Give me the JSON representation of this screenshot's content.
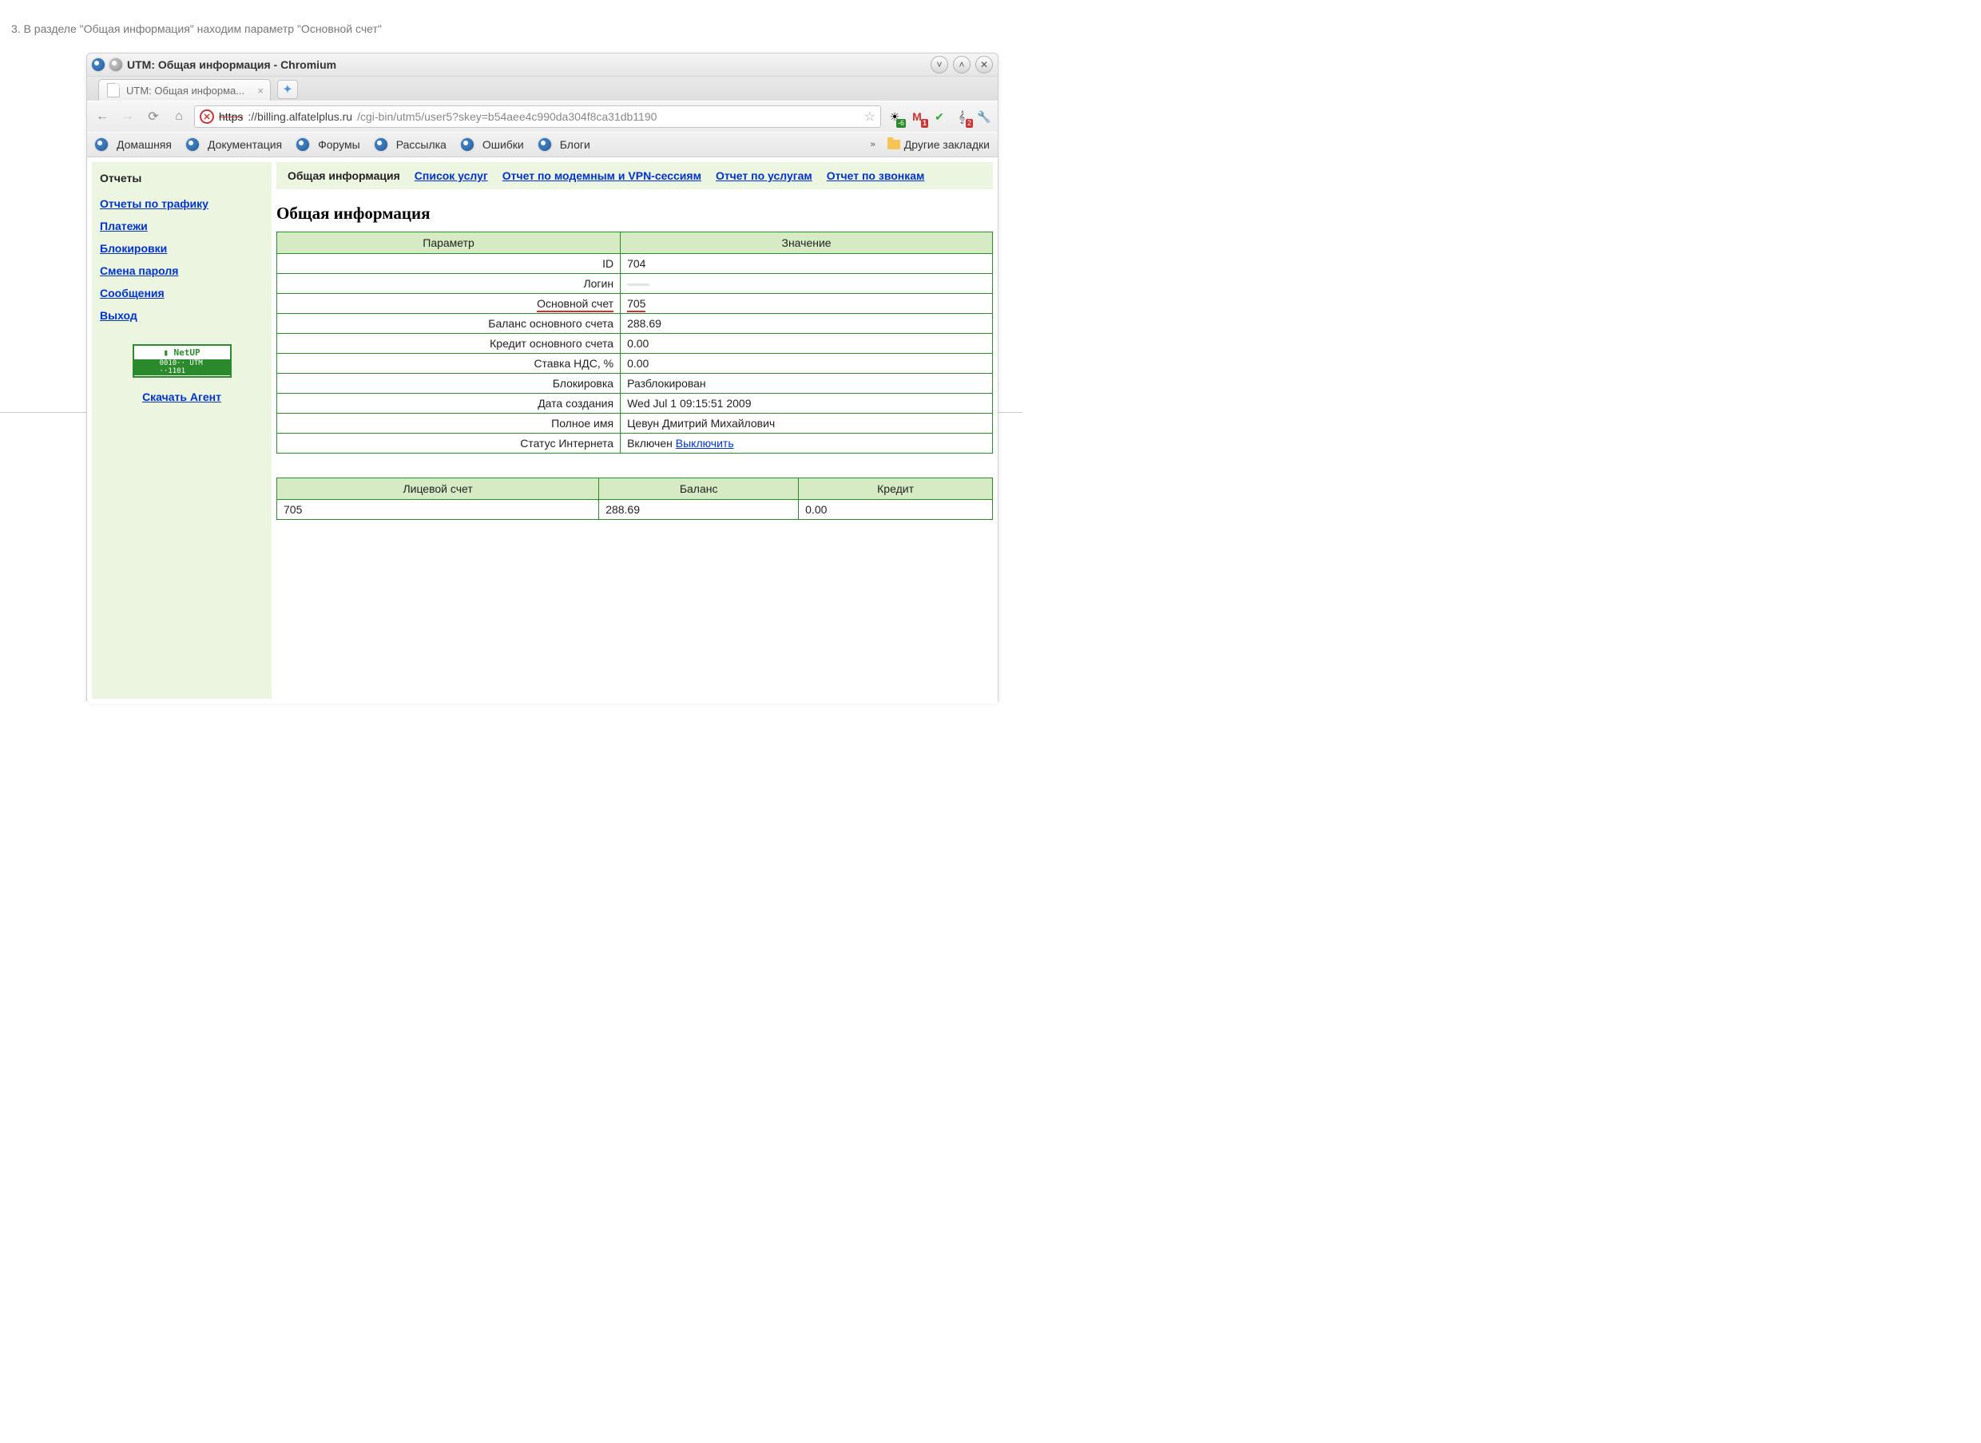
{
  "instruction": "3. В разделе \"Общая информация\" находим параметр \"Основной счет\"",
  "window": {
    "title": "UTM: Общая информация - Chromium",
    "tab_title": "UTM: Общая информа...",
    "url_https": "https",
    "url_host": "://billing.alfatelplus.ru",
    "url_path": "/cgi-bin/utm5/user5?skey=b54aee4c990da304f8ca31db1190"
  },
  "toolbar_badges": {
    "weather": "-6",
    "gmail": "1",
    "music": "2"
  },
  "bookmarks": {
    "items": [
      "Домашняя",
      "Документация",
      "Форумы",
      "Рассылка",
      "Ошибки",
      "Блоги"
    ],
    "other": "Другие закладки"
  },
  "sidebar": {
    "heading": "Отчеты",
    "items": [
      "Отчеты по трафику",
      "Платежи",
      "Блокировки",
      "Смена пароля",
      "Сообщения",
      "Выход"
    ],
    "netup_top": "▮ NetUP",
    "netup_bottom": "0010·· UTM ··1101",
    "agent": "Скачать Агент"
  },
  "subnav": {
    "active": "Общая информация",
    "items": [
      "Список услуг",
      "Отчет по модемным и VPN-сессиям",
      "Отчет по услугам",
      "Отчет по звонкам"
    ]
  },
  "section_title": "Общая информация",
  "info_headers": {
    "param": "Параметр",
    "value": "Значение"
  },
  "info_rows": [
    {
      "param": "ID",
      "value": "704"
    },
    {
      "param": "Логин",
      "value": "——"
    },
    {
      "param": "Основной счет",
      "value": "705",
      "highlight": true
    },
    {
      "param": "Баланс основного счета",
      "value": "288.69"
    },
    {
      "param": "Кредит основного счета",
      "value": "0.00"
    },
    {
      "param": "Ставка НДС, %",
      "value": "0.00"
    },
    {
      "param": "Блокировка",
      "value": "Разблокирован"
    },
    {
      "param": "Дата создания",
      "value": "Wed Jul 1 09:15:51 2009"
    },
    {
      "param": "Полное имя",
      "value": "Цевун Дмитрий Михайлович"
    },
    {
      "param": "Статус Интернета",
      "value": "Включен ",
      "link": "Выключить"
    }
  ],
  "acct_headers": [
    "Лицевой счет",
    "Баланс",
    "Кредит"
  ],
  "acct_row": [
    "705",
    "288.69",
    "0.00"
  ]
}
